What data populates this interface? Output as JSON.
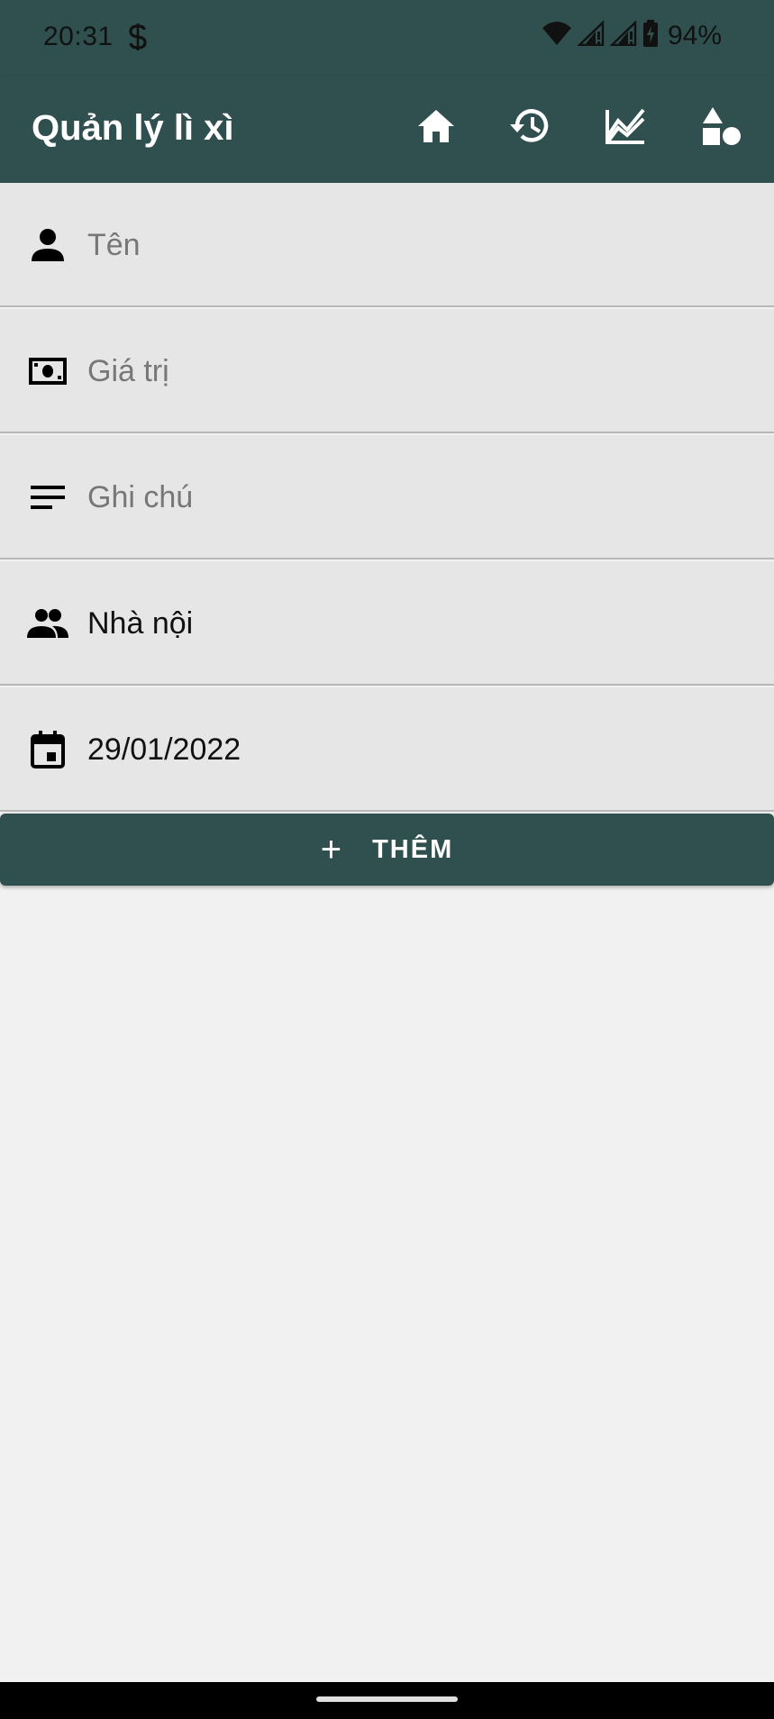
{
  "status_bar": {
    "time": "20:31",
    "battery_percent": "94%",
    "icons": [
      "s-icon",
      "wifi-icon",
      "signal-icon",
      "signal-icon",
      "battery-charging-icon"
    ]
  },
  "app_bar": {
    "title": "Quản lý lì xì",
    "actions": [
      "home-icon",
      "history-icon",
      "chart-icon",
      "shapes-icon"
    ]
  },
  "form": {
    "name": {
      "placeholder": "Tên",
      "value": "",
      "icon": "person-icon"
    },
    "amount": {
      "placeholder": "Giá trị",
      "value": "",
      "icon": "money-icon"
    },
    "note": {
      "placeholder": "Ghi chú",
      "value": "",
      "icon": "notes-icon"
    },
    "family": {
      "value": "Nhà nội",
      "icon": "group-icon"
    },
    "date": {
      "value": "29/01/2022",
      "icon": "calendar-icon"
    }
  },
  "add_button": {
    "plus": "+",
    "label": "THÊM"
  },
  "colors": {
    "primary": "#30504f",
    "field_bg": "#e6e6e6",
    "page_bg": "#f1f1f1"
  }
}
